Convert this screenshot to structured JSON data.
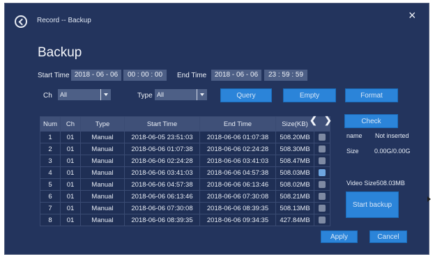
{
  "breadcrumb": "Record -- Backup",
  "close_icon": "×",
  "title": "Backup",
  "start_time": {
    "label": "Start Time",
    "date": "2018 - 06 - 06",
    "time": "00 : 00 : 00"
  },
  "end_time": {
    "label": "End Time",
    "date": "2018 - 06 - 06",
    "time": "23 : 59 : 59"
  },
  "ch": {
    "label": "Ch",
    "value": "All"
  },
  "type": {
    "label": "Type",
    "value": "All"
  },
  "buttons": {
    "query": "Query",
    "empty": "Empty",
    "format": "Format",
    "check": "Check",
    "start_backup": "Start backup",
    "apply": "Apply",
    "cancel": "Cancel"
  },
  "table": {
    "headers": [
      "Num",
      "Ch",
      "Type",
      "Start Time",
      "End Time",
      "Size(KB)"
    ],
    "rows": [
      {
        "num": "1",
        "ch": "01",
        "type": "Manual",
        "start": "2018-06-05 23:51:03",
        "end": "2018-06-06 01:07:38",
        "size": "508.20MB",
        "checked": false
      },
      {
        "num": "2",
        "ch": "01",
        "type": "Manual",
        "start": "2018-06-06 01:07:38",
        "end": "2018-06-06 02:24:28",
        "size": "508.30MB",
        "checked": false
      },
      {
        "num": "3",
        "ch": "01",
        "type": "Manual",
        "start": "2018-06-06 02:24:28",
        "end": "2018-06-06 03:41:03",
        "size": "508.47MB",
        "checked": false
      },
      {
        "num": "4",
        "ch": "01",
        "type": "Manual",
        "start": "2018-06-06 03:41:03",
        "end": "2018-06-06 04:57:38",
        "size": "508.03MB",
        "checked": true
      },
      {
        "num": "5",
        "ch": "01",
        "type": "Manual",
        "start": "2018-06-06 04:57:38",
        "end": "2018-06-06 06:13:46",
        "size": "508.02MB",
        "checked": false
      },
      {
        "num": "6",
        "ch": "01",
        "type": "Manual",
        "start": "2018-06-06 06:13:46",
        "end": "2018-06-06 07:30:08",
        "size": "508.21MB",
        "checked": false
      },
      {
        "num": "7",
        "ch": "01",
        "type": "Manual",
        "start": "2018-06-06 07:30:08",
        "end": "2018-06-06 08:39:35",
        "size": "508.13MB",
        "checked": false
      },
      {
        "num": "8",
        "ch": "01",
        "type": "Manual",
        "start": "2018-06-06 08:39:35",
        "end": "2018-06-06 09:34:35",
        "size": "427.84MB",
        "checked": false
      }
    ]
  },
  "device": {
    "name_label": "name",
    "name_value": "Not inserted",
    "size_label": "Size",
    "size_value": "0.00G/0.00G"
  },
  "video_size": "Video Size508.03MB",
  "nav": {
    "prev": "❮",
    "next": "❯"
  }
}
